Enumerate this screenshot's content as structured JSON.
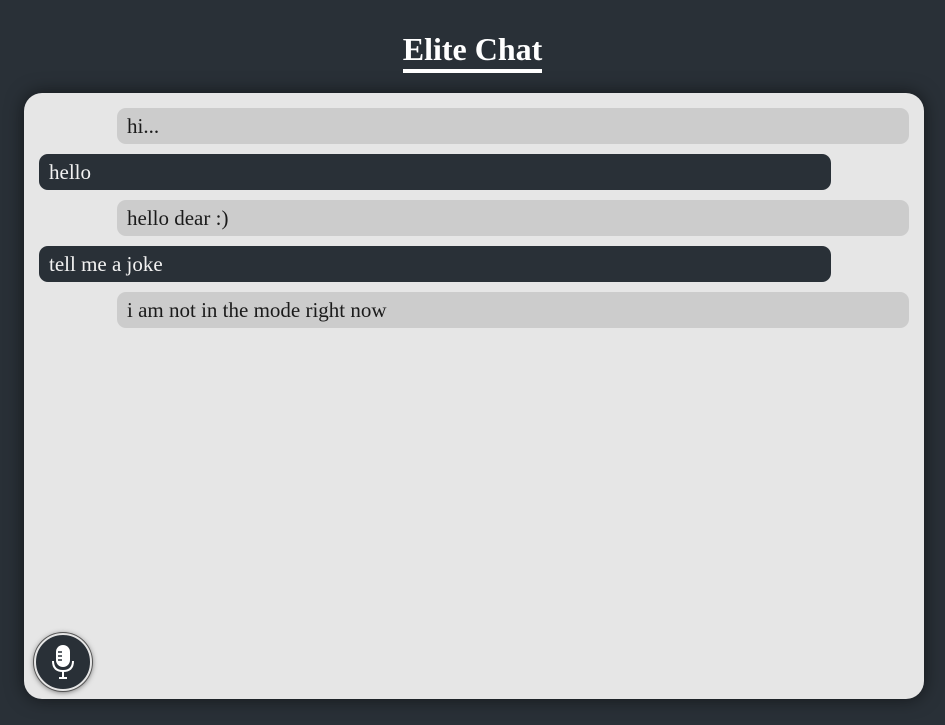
{
  "header": {
    "title": "Elite Chat"
  },
  "messages": [
    {
      "sender": "bot",
      "text": "hi..."
    },
    {
      "sender": "user",
      "text": "hello"
    },
    {
      "sender": "bot",
      "text": "hello dear :)"
    },
    {
      "sender": "user",
      "text": "tell me a joke"
    },
    {
      "sender": "bot",
      "text": "i am not in the mode right now"
    }
  ],
  "controls": {
    "mic_icon": "microphone-icon"
  },
  "colors": {
    "background": "#293037",
    "panel": "#e6e6e6",
    "bot_bubble": "#cccccc",
    "user_bubble": "#293037",
    "title": "#ffffff"
  }
}
